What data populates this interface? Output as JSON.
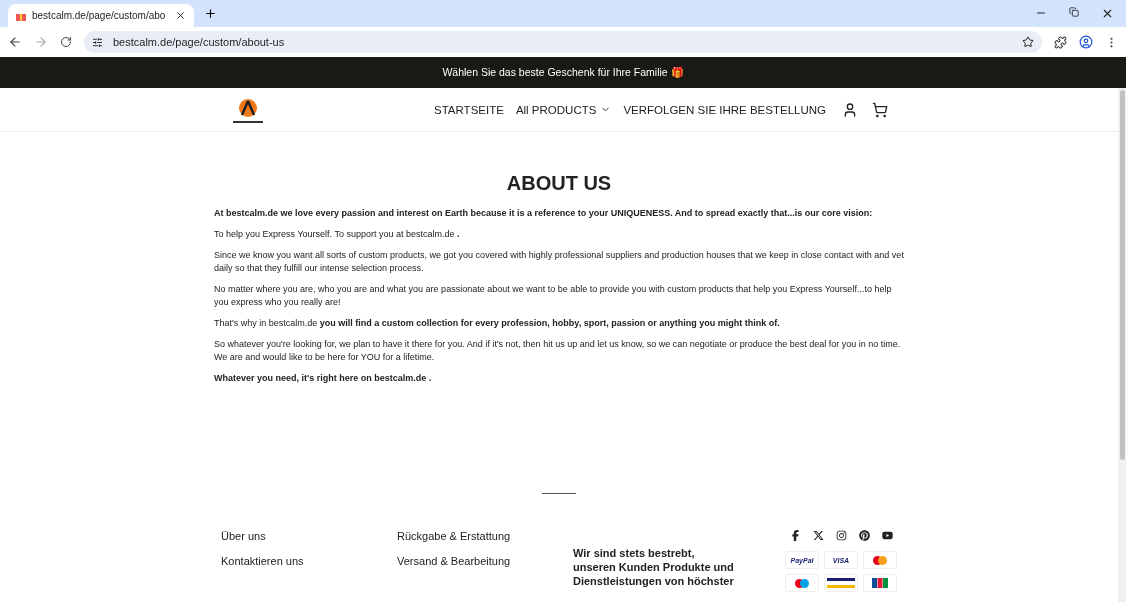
{
  "browser": {
    "tab": {
      "title": "bestcalm.de/page/custom/abo",
      "selected": true
    },
    "address": "bestcalm.de/page/custom/about-us"
  },
  "banner": {
    "text": "Wählen Sie das beste Geschenk für Ihre Familie 🎁"
  },
  "nav": {
    "items": [
      {
        "label": "STARTSEITE",
        "dropdown": false
      },
      {
        "label": "All PRODUCTS",
        "dropdown": true
      },
      {
        "label": "VERFOLGEN SIE IHRE BESTELLUNG",
        "dropdown": false
      }
    ]
  },
  "page": {
    "title": "ABOUT US",
    "paragraphs": [
      {
        "text": "At bestcalm.de  we love every passion and interest on Earth because it is a reference to your UNIQUENESS. And to spread exactly that...is our core vision:",
        "bold": true
      },
      {
        "text": "To help you Express Yourself. To support you at bestcalm.de **.**",
        "bold": false
      },
      {
        "text": "Since we know you want all sorts of custom products, we got you covered with highly professional suppliers and production houses that we keep in close contact with and vet daily so that they fulfill our intense selection process.",
        "bold": false
      },
      {
        "text": "No matter where you are, who you are and what you are passionate about we want to be able to provide you with custom products that help you Express Yourself...to help you express who you really are!",
        "bold": false
      },
      {
        "text": "That's why in bestcalm.de  **you will find a custom collection for every profession, hobby, sport, passion or anything you might think of.**",
        "bold": false
      },
      {
        "text": "So whatever you're looking for, we plan to have it there for you. And if it's not, then hit us up and let us know, so we can negotiate or produce the best deal for you in no time. We are and would like to be here for YOU for a lifetime.",
        "bold": false
      },
      {
        "text": "Whatever you need, it's right here on bestcalm.de .",
        "bold": true
      }
    ]
  },
  "footer": {
    "column_1": [
      "Über uns",
      "Kontaktieren uns"
    ],
    "column_2": [
      "Rückgabe & Erstattung",
      "Versand & Bearbeitung"
    ],
    "tagline": [
      "Wir sind stets bestrebt,",
      "unseren Kunden Produkte und",
      "Dienstleistungen von höchster"
    ],
    "payments": [
      {
        "kind": "paypal",
        "label": "PayPal"
      },
      {
        "kind": "visa",
        "label": "VISA"
      },
      {
        "kind": "mastercard"
      },
      {
        "kind": "maestro"
      },
      {
        "kind": "card"
      },
      {
        "kind": "jcb"
      }
    ]
  }
}
